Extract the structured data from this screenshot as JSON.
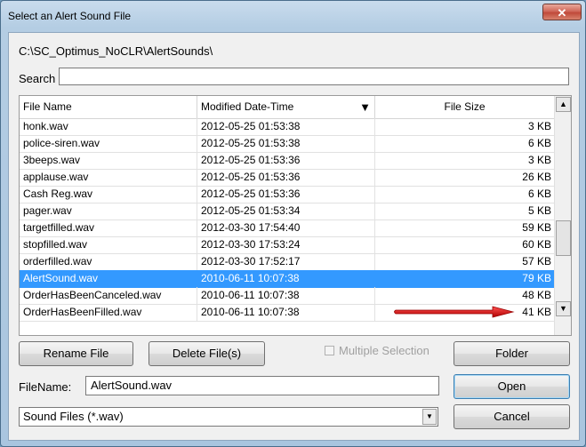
{
  "window": {
    "title": "Select an Alert Sound File",
    "close_glyph": "✕"
  },
  "path": "C:\\SC_Optimus_NoCLR\\AlertSounds\\",
  "search": {
    "label": "Search",
    "value": ""
  },
  "table": {
    "headers": [
      "File Name",
      "Modified Date-Time",
      "File Size"
    ],
    "sort_column": "Modified Date-Time",
    "sort_direction": "descending",
    "selected_index": 9,
    "rows": [
      {
        "name": "honk.wav",
        "modified": "2012-05-25  01:53:38",
        "size": "3 KB"
      },
      {
        "name": "police-siren.wav",
        "modified": "2012-05-25  01:53:38",
        "size": "6 KB"
      },
      {
        "name": "3beeps.wav",
        "modified": "2012-05-25  01:53:36",
        "size": "3 KB"
      },
      {
        "name": "applause.wav",
        "modified": "2012-05-25  01:53:36",
        "size": "26 KB"
      },
      {
        "name": "Cash Reg.wav",
        "modified": "2012-05-25  01:53:36",
        "size": "6 KB"
      },
      {
        "name": "pager.wav",
        "modified": "2012-05-25  01:53:34",
        "size": "5 KB"
      },
      {
        "name": "targetfilled.wav",
        "modified": "2012-03-30  17:54:40",
        "size": "59 KB"
      },
      {
        "name": "stopfilled.wav",
        "modified": "2012-03-30  17:53:24",
        "size": "60 KB"
      },
      {
        "name": "orderfilled.wav",
        "modified": "2012-03-30  17:52:17",
        "size": "57 KB"
      },
      {
        "name": "AlertSound.wav",
        "modified": "2010-06-11  10:07:38",
        "size": "79 KB"
      },
      {
        "name": "OrderHasBeenCanceled.wav",
        "modified": "2010-06-11  10:07:38",
        "size": "48 KB"
      },
      {
        "name": "OrderHasBeenFilled.wav",
        "modified": "2010-06-11  10:07:38",
        "size": "41 KB"
      }
    ]
  },
  "buttons": {
    "rename": "Rename File",
    "delete": "Delete File(s)",
    "folder": "Folder",
    "open": "Open",
    "cancel": "Cancel"
  },
  "multiple_selection": {
    "label": "Multiple Selection",
    "checked": false,
    "enabled": false
  },
  "filename": {
    "label": "FileName:",
    "value": "AlertSound.wav"
  },
  "filetype": {
    "selected": "Sound Files (*.wav)"
  },
  "colors": {
    "selection": "#3399ff",
    "annotation_arrow": "#e01010"
  }
}
